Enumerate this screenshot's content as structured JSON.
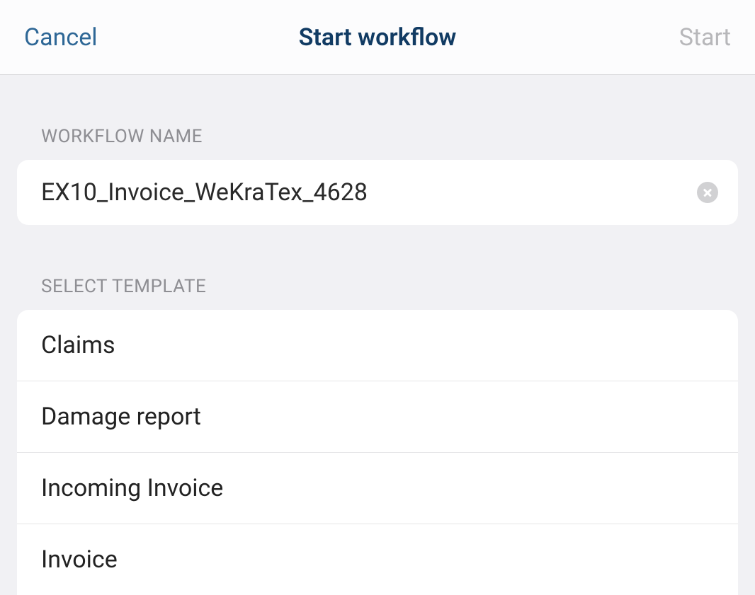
{
  "header": {
    "cancel_label": "Cancel",
    "title": "Start workflow",
    "start_label": "Start"
  },
  "sections": {
    "workflow_name_label": "WORKFLOW NAME",
    "select_template_label": "SELECT TEMPLATE"
  },
  "workflow": {
    "name_value": "EX10_Invoice_WeKraTex_4628"
  },
  "templates": [
    {
      "label": "Claims"
    },
    {
      "label": "Damage report"
    },
    {
      "label": "Incoming Invoice"
    },
    {
      "label": "Invoice"
    }
  ]
}
